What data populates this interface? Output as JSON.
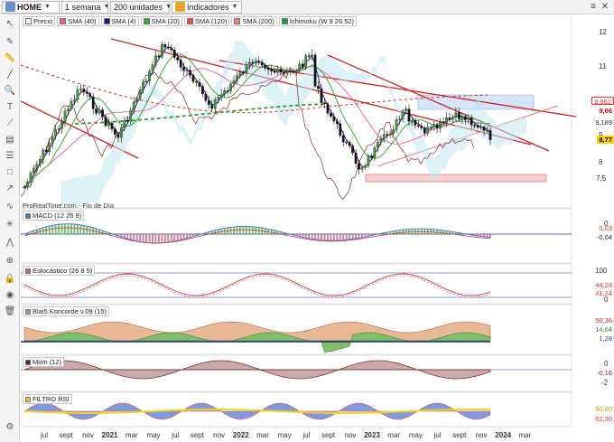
{
  "toolbar": {
    "symbol": "HOME",
    "timeframe": "1 semana",
    "units": "200 unidades",
    "indicators_label": "Indicadores"
  },
  "main_panel": {
    "legend": [
      {
        "label": "Precio",
        "color": "#ffffff"
      },
      {
        "label": "SMA (40)",
        "color": "#e35b9d"
      },
      {
        "label": "SMA (4)",
        "color": "#1c1c7a"
      },
      {
        "label": "SMA (20)",
        "color": "#3aa83a"
      },
      {
        "label": "SMA (120)",
        "color": "#e84e4e"
      },
      {
        "label": "SMA (200)",
        "color": "#f08080"
      },
      {
        "label": "Ichimoku (W 9 26 52)",
        "color": "#14a050"
      }
    ],
    "source": "ProRealTime.com - Fin de Día",
    "y_ticks": [
      "12",
      "11",
      "10",
      "9",
      "8",
      "7,5"
    ],
    "price_tags": [
      {
        "label": "9,962",
        "bg": "#ffffff",
        "fg": "#d33"
      },
      {
        "label": "9,66",
        "bg": "#ffffff",
        "fg": "#c00"
      },
      {
        "label": "9,189",
        "bg": "#ffffff",
        "fg": "#333"
      },
      {
        "label": "8,77",
        "bg": "#ffd200",
        "fg": "#000"
      }
    ]
  },
  "panels": [
    {
      "id": "macd",
      "label": "MACD (12 26 9)",
      "tags": [
        "0,03",
        "-0,04"
      ],
      "axis": [
        "0"
      ]
    },
    {
      "id": "stoch",
      "label": "Estocástico (26 8 5)",
      "tags": [
        "44,28",
        "41,24"
      ],
      "axis": [
        "100",
        "0"
      ]
    },
    {
      "id": "blai5",
      "label": "Blai5 Koncorde v.09 (15)",
      "tags": [
        "50,36",
        "14,64",
        "1,28"
      ],
      "axis": []
    },
    {
      "id": "mom",
      "label": "Mom (12)",
      "tags": [
        "-0,16"
      ],
      "axis": [
        "0",
        "-2"
      ]
    },
    {
      "id": "rsi",
      "label": "FILTRO RSI",
      "tags": [
        "50,80",
        "52,30"
      ],
      "axis": []
    }
  ],
  "x_axis": [
    {
      "label": "jul",
      "bold": false
    },
    {
      "label": "sept",
      "bold": false
    },
    {
      "label": "nov",
      "bold": false
    },
    {
      "label": "2021",
      "bold": true
    },
    {
      "label": "mar",
      "bold": false
    },
    {
      "label": "may",
      "bold": false
    },
    {
      "label": "jul",
      "bold": false
    },
    {
      "label": "sept",
      "bold": false
    },
    {
      "label": "nov",
      "bold": false
    },
    {
      "label": "2022",
      "bold": true
    },
    {
      "label": "mar",
      "bold": false
    },
    {
      "label": "may",
      "bold": false
    },
    {
      "label": "jul",
      "bold": false
    },
    {
      "label": "sept",
      "bold": false
    },
    {
      "label": "nov",
      "bold": false
    },
    {
      "label": "2023",
      "bold": true
    },
    {
      "label": "mar",
      "bold": false
    },
    {
      "label": "may",
      "bold": false
    },
    {
      "label": "jul",
      "bold": false
    },
    {
      "label": "sept",
      "bold": false
    },
    {
      "label": "nov",
      "bold": false
    },
    {
      "label": "2024",
      "bold": true
    },
    {
      "label": "mar",
      "bold": false
    }
  ],
  "tools": [
    "pointer-icon",
    "pencil-icon",
    "ruler-icon",
    "line-icon",
    "zoom-icon",
    "text-icon",
    "trendline-icon",
    "channel-icon",
    "fibonacci-icon",
    "shapes-icon",
    "arrow-icon",
    "cycle-icon",
    "gann-icon",
    "pattern-icon",
    "magnet-icon",
    "trash-icon"
  ]
}
